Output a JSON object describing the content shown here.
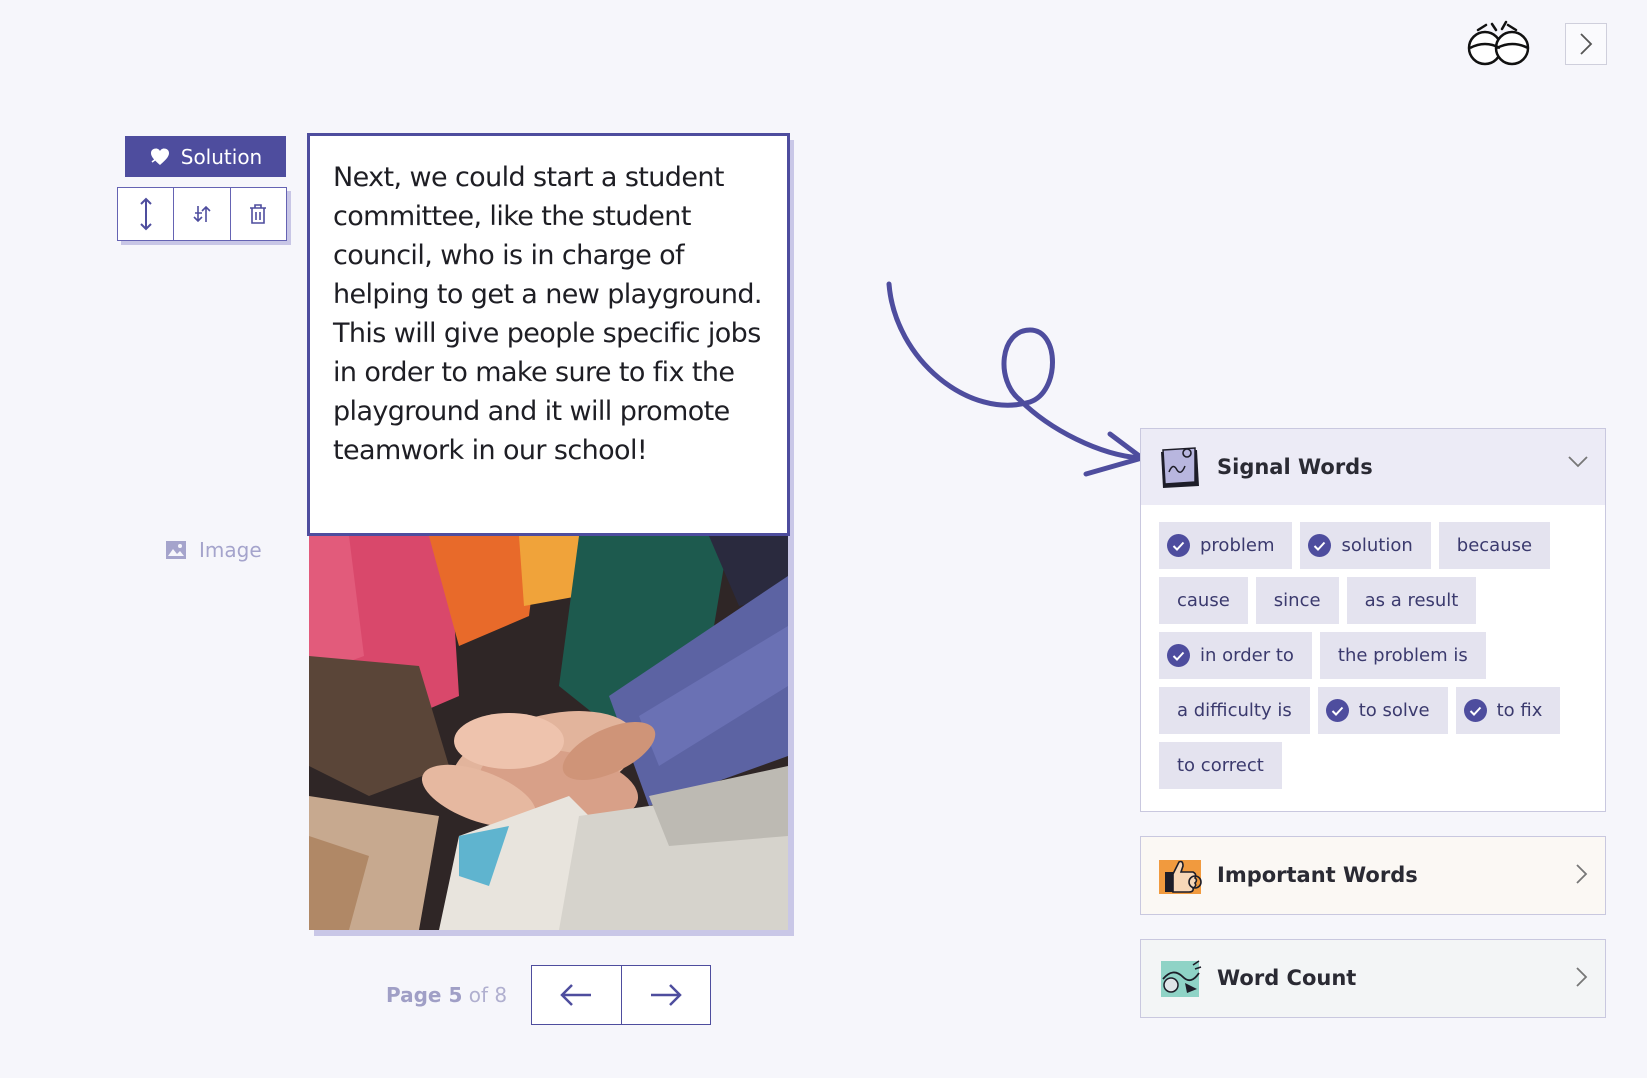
{
  "header": {
    "mascot_icon": "eyes-mascot-icon",
    "collapse_icon": "chevron-right-icon"
  },
  "toolbar": {
    "tag_label": "Solution",
    "tag_icon": "heart-icon",
    "buttons": [
      "resize-vertical-icon",
      "swap-icon",
      "trash-icon"
    ]
  },
  "image_label": "Image",
  "page": {
    "text": "Next, we could start a student committee, like the student council, who is in charge of helping to get a new playground. This will give people specific jobs in order to make sure to fix the playground and it will promote teamwork in our school!",
    "photo_description_icon": "photo"
  },
  "pager": {
    "current": "5",
    "total": "8",
    "page_word": "Page",
    "of_word": "of"
  },
  "panels": {
    "signal": {
      "title": "Signal Words",
      "words": [
        {
          "label": "problem",
          "checked": true
        },
        {
          "label": "solution",
          "checked": true
        },
        {
          "label": "because",
          "checked": false
        },
        {
          "label": "cause",
          "checked": false
        },
        {
          "label": "since",
          "checked": false
        },
        {
          "label": "as a result",
          "checked": false
        },
        {
          "label": "in order to",
          "checked": true
        },
        {
          "label": "the problem is",
          "checked": false
        },
        {
          "label": "a difficulty is",
          "checked": false
        },
        {
          "label": "to solve",
          "checked": true
        },
        {
          "label": "to fix",
          "checked": true
        },
        {
          "label": "to correct",
          "checked": false
        }
      ]
    },
    "important": {
      "title": "Important Words"
    },
    "wordcount": {
      "title": "Word Count"
    }
  },
  "colors": {
    "accent": "#4e4d9e",
    "background": "#f6f6fb",
    "chip": "#e4e3ef"
  }
}
